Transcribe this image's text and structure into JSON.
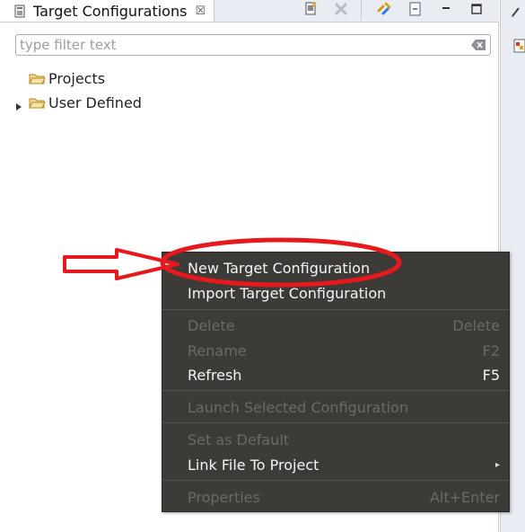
{
  "view": {
    "title": "Target Configurations",
    "close_glyph": "☒"
  },
  "filter": {
    "placeholder": "type filter text",
    "value": ""
  },
  "tree": [
    {
      "label": "Projects",
      "expandable": false
    },
    {
      "label": "User Defined",
      "expandable": true
    }
  ],
  "menu": {
    "items": [
      {
        "label": "New Target Configuration",
        "accel": "",
        "enabled": true
      },
      {
        "label": "Import Target Configuration",
        "accel": "",
        "enabled": true
      },
      {
        "label": "Delete",
        "accel": "Delete",
        "enabled": false
      },
      {
        "label": "Rename",
        "accel": "F2",
        "enabled": false
      },
      {
        "label": "Refresh",
        "accel": "F5",
        "enabled": true
      },
      {
        "label": "Launch Selected Configuration",
        "accel": "",
        "enabled": false
      },
      {
        "label": "Set as Default",
        "accel": "",
        "enabled": false
      },
      {
        "label": "Link File To Project",
        "accel": "",
        "enabled": true,
        "submenu": true
      },
      {
        "label": "Properties",
        "accel": "Alt+Enter",
        "enabled": false
      }
    ]
  },
  "icons": [
    "target-config-icon",
    "new-config-icon",
    "remove-icon",
    "link-editor-icon",
    "collapse-all-icon",
    "minimize-icon",
    "maximize-icon",
    "clear-filter-icon",
    "folder-icon",
    "expand-arrow-icon",
    "submenu-arrow-icon"
  ],
  "colors": {
    "menu_bg": "#3c3b37",
    "menu_text": "#f4f4f4",
    "menu_disabled": "#6b6a65",
    "annotation_red": "#e8191d"
  }
}
